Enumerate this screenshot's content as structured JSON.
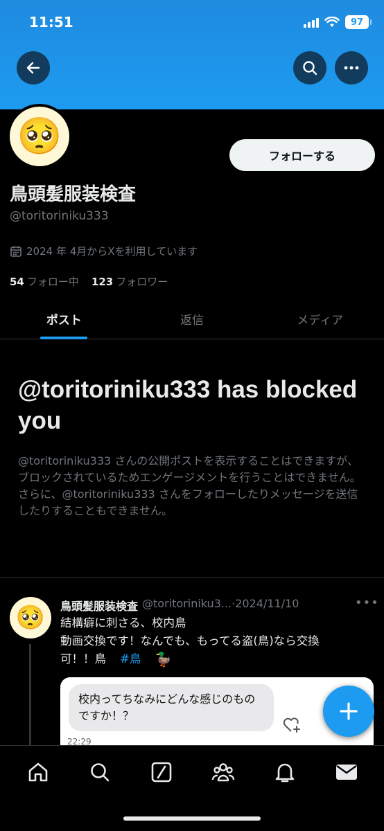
{
  "status_bar": {
    "time": "11:51",
    "battery": "97"
  },
  "profile": {
    "display_name": "鳥頭髪服装検査",
    "handle": "@toritoriniku333",
    "joined": "2024 年 4月からXを利用しています",
    "following_count": "54",
    "following_label": "フォロー中",
    "followers_count": "123",
    "followers_label": "フォロワー",
    "follow_button": "フォローする",
    "avatar_emoji": "🥺"
  },
  "tabs": [
    {
      "label": "ポスト",
      "active": true
    },
    {
      "label": "返信",
      "active": false
    },
    {
      "label": "メディア",
      "active": false
    }
  ],
  "blocked": {
    "title": "@toritoriniku333 has blocked you",
    "body": "@toritoriniku333 さんの公開ポストを表示することはできますが、ブロックされているためエンゲージメントを行うことはできません。さらに、@toritoriniku333 さんをフォローしたりメッセージを送信したりすることもできません。"
  },
  "post": {
    "name": "鳥頭髪服装検査",
    "handle": "@toritoriniku3...",
    "dot": "·",
    "date": "2024/11/10",
    "line1": "結構癖に刺さる、校内鳥",
    "line2": "動画交換です！なんでも、もってる盗(鳥)なら交換",
    "line3": "可！！鳥",
    "hashtag": "#鳥",
    "emoji": "🦆",
    "card_message": "校内ってちなみにどんな感じのものですか！？",
    "card_time": "22:29"
  },
  "colors": {
    "accent": "#1d9bf0",
    "banner": "#1d9bf0",
    "background": "#000000",
    "muted": "#71767b"
  },
  "icons": [
    "back-arrow-icon",
    "search-icon",
    "more-icon",
    "calendar-icon",
    "home-icon",
    "explore-icon",
    "grok-icon",
    "communities-icon",
    "notifications-icon",
    "messages-icon",
    "compose-plus-icon",
    "react-heart-icon"
  ]
}
